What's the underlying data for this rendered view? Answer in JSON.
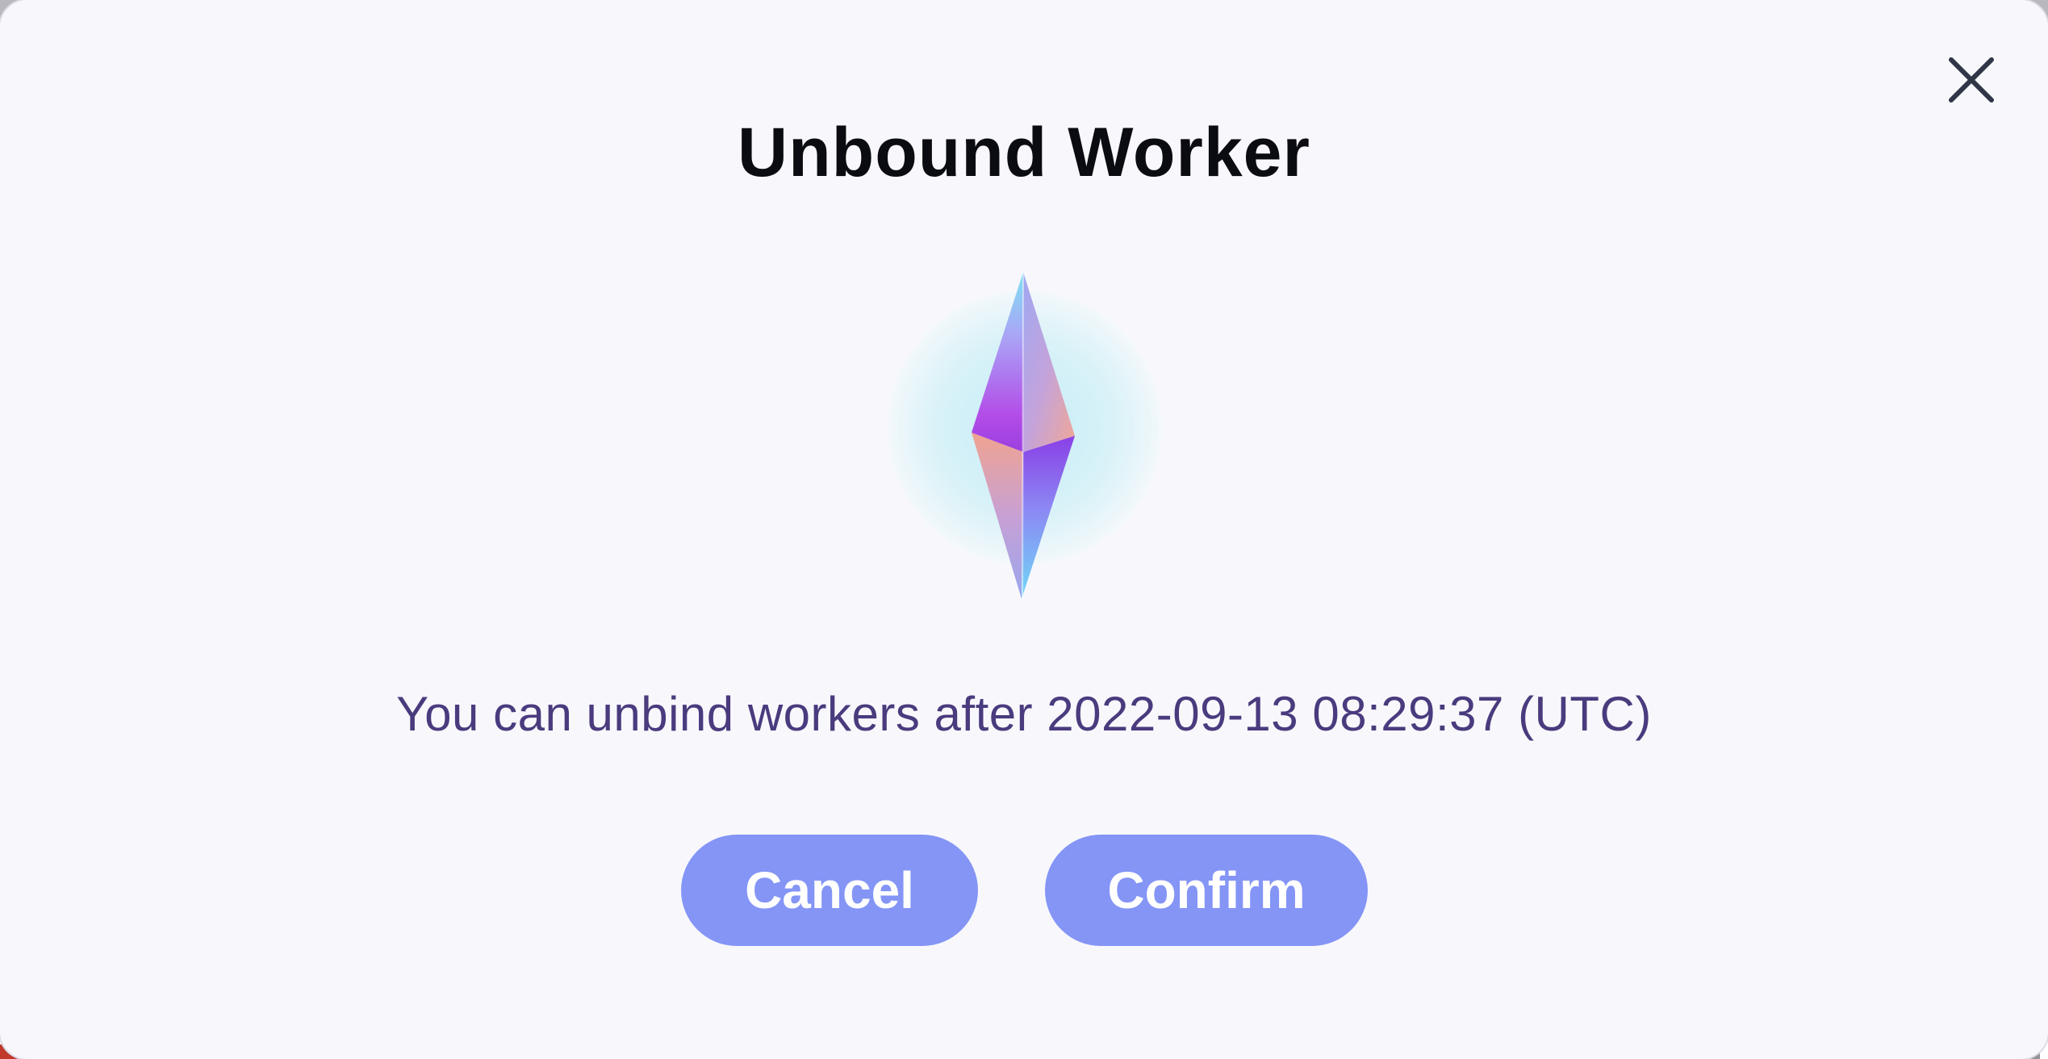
{
  "modal": {
    "title": "Unbound Worker",
    "message": "You can unbind workers after 2022-09-13 08:29:37 (UTC)",
    "close_icon": "close-icon",
    "illustration_icon": "crystal-gem-icon",
    "buttons": {
      "cancel_label": "Cancel",
      "confirm_label": "Confirm"
    }
  },
  "colors": {
    "accent": "#8495f6",
    "title": "#0b0b12",
    "message": "#4a3b7e",
    "modal_background": "#f8f8fc"
  }
}
